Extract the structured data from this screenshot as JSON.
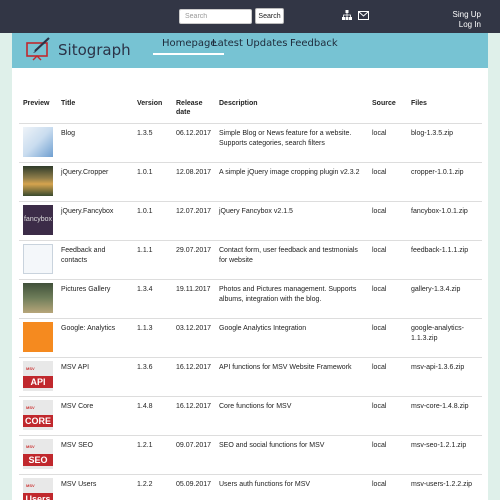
{
  "header": {
    "search_placeholder": "Search",
    "search_button": "Search",
    "signup": "Sing Up",
    "login": "Log In"
  },
  "nav": {
    "brand": "Sitograph",
    "items": [
      {
        "label": "Homepage",
        "active": true
      },
      {
        "label": "Latest Updates",
        "active": false
      },
      {
        "label": "Feedback",
        "active": false
      }
    ]
  },
  "table": {
    "headers": {
      "preview": "Preview",
      "title": "Title",
      "version": "Version",
      "release_date": "Release date",
      "description": "Description",
      "source": "Source",
      "files": "Files"
    },
    "rows": [
      {
        "title": "Blog",
        "version": "1.3.5",
        "date": "06.12.2017",
        "description": "Simple Blog or News feature for a website. Supports categories, search filters",
        "source": "local",
        "file": "blog-1.3.5.zip",
        "thumb": "blog"
      },
      {
        "title": "jQuery.Cropper",
        "version": "1.0.1",
        "date": "12.08.2017",
        "description": "A simple jQuery image cropping plugin v2.3.2",
        "source": "local",
        "file": "cropper-1.0.1.zip",
        "thumb": "cropper"
      },
      {
        "title": "jQuery.Fancybox",
        "version": "1.0.1",
        "date": "12.07.2017",
        "description": "jQuery Fancybox v2.1.5",
        "source": "local",
        "file": "fancybox-1.0.1.zip",
        "thumb": "fancy",
        "thumb_text": "fancybox"
      },
      {
        "title": "Feedback and contacts",
        "version": "1.1.1",
        "date": "29.07.2017",
        "description": "Contact form, user feedback and testmonials for website",
        "source": "local",
        "file": "feedback-1.1.1.zip",
        "thumb": "feedback"
      },
      {
        "title": "Pictures Gallery",
        "version": "1.3.4",
        "date": "19.11.2017",
        "description": "Photos and Pictures management. Supports albums, integration with the blog.",
        "source": "local",
        "file": "gallery-1.3.4.zip",
        "thumb": "gallery"
      },
      {
        "title": "Google: Analytics",
        "version": "1.1.3",
        "date": "03.12.2017",
        "description": "Google Analytics Integration",
        "source": "local",
        "file": "google-analytics-1.1.3.zip",
        "thumb": "analytics"
      },
      {
        "title": "MSV API",
        "version": "1.3.6",
        "date": "16.12.2017",
        "description": "API functions for MSV Website Framework",
        "source": "local",
        "file": "msv-api-1.3.6.zip",
        "thumb": "msv",
        "thumb_text": "API"
      },
      {
        "title": "MSV Core",
        "version": "1.4.8",
        "date": "16.12.2017",
        "description": "Core functions for MSV",
        "source": "local",
        "file": "msv-core-1.4.8.zip",
        "thumb": "msv",
        "thumb_text": "CORE"
      },
      {
        "title": "MSV SEO",
        "version": "1.2.1",
        "date": "09.07.2017",
        "description": "SEO and social functions for MSV",
        "source": "local",
        "file": "msv-seo-1.2.1.zip",
        "thumb": "msv",
        "thumb_text": "SEO"
      },
      {
        "title": "MSV Users",
        "version": "1.2.2",
        "date": "05.09.2017",
        "description": "Users auth functions for MSV",
        "source": "local",
        "file": "msv-users-1.2.2.zip",
        "thumb": "msv",
        "thumb_text": "Users"
      }
    ]
  },
  "colors": {
    "topbar": "#323645",
    "nav": "#77c3d3",
    "page_bg": "#dff0ea",
    "msv_badge": "#c0282d"
  },
  "icons": [
    "sitemap-icon",
    "mail-icon",
    "sitograph-logo-icon"
  ]
}
